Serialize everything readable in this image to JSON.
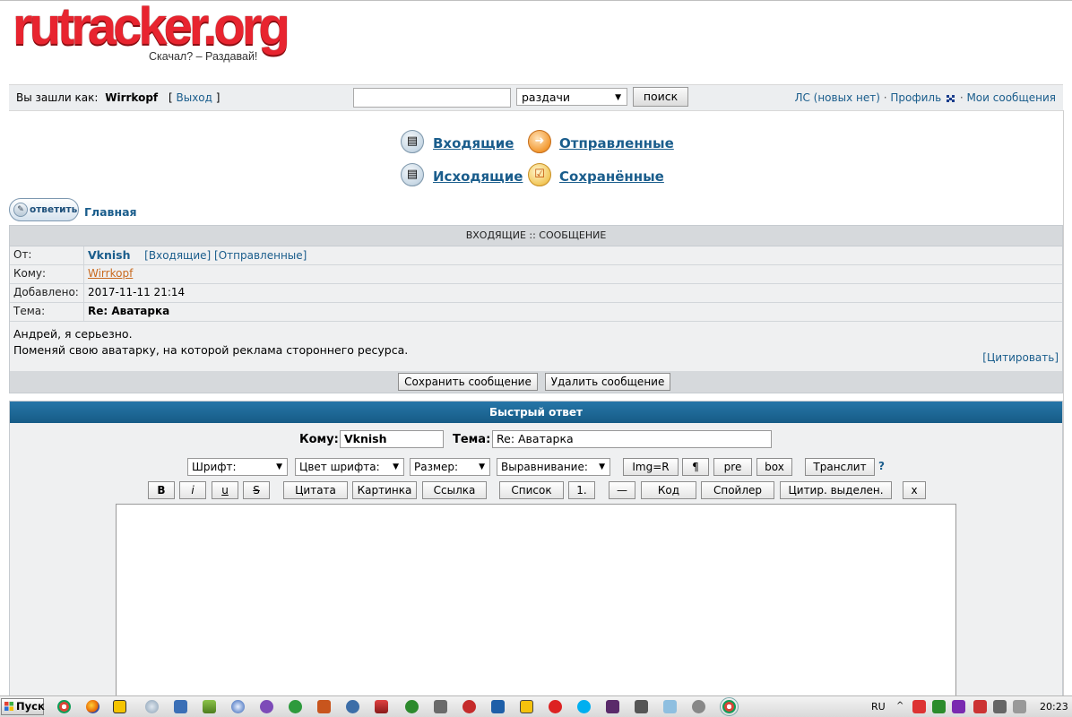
{
  "logo": {
    "text": "rutracker.org",
    "slogan": "Скачал? – Раздавай!"
  },
  "topbar": {
    "logged_as_label": "Вы зашли как:",
    "username": "Wirrkopf",
    "logout_label": "Выход",
    "search_value": "",
    "search_scope": "раздачи",
    "search_button": "поиск",
    "pm_link": "ЛС (новых нет)",
    "profile_link": "Профиль",
    "my_posts_link": "Мои сообщения"
  },
  "folders": {
    "inbox": "Входящие",
    "sent": "Отправленные",
    "outbox": "Исходящие",
    "saved": "Сохранённые"
  },
  "nav": {
    "reply_button": "ответить",
    "breadcrumb": "Главная"
  },
  "message": {
    "header": "ВХОДЯЩИЕ :: СООБЩЕНИЕ",
    "from_label": "От:",
    "from_value": "Vknish",
    "from_inbox_link": "[Входящие]",
    "from_sent_link": "[Отправленные]",
    "to_label": "Кому:",
    "to_value": "Wirrkopf",
    "date_label": "Добавлено:",
    "date_value": "2017-11-11 21:14",
    "subject_label": "Тема:",
    "subject_value": "Re: Аватарка",
    "body_line1": "Андрей, я серьезно.",
    "body_line2": "Поменяй свою аватарку, на которой реклама стороннего ресурса.",
    "quote_link": "[Цитировать]",
    "save_button": "Сохранить сообщение",
    "delete_button": "Удалить сообщение"
  },
  "quick_reply": {
    "title": "Быстрый ответ",
    "to_label": "Кому:",
    "to_value": "Vknish",
    "subject_label": "Тема:",
    "subject_value": "Re: Аватарка",
    "font_select": "Шрифт:",
    "color_select": "Цвет шрифта:",
    "size_select": "Размер:",
    "align_select": "Выравнивание:",
    "img_r": "Img=R",
    "pilcrow": "¶",
    "pre": "pre",
    "box": "box",
    "translit": "Транслит",
    "help": "?",
    "bold": "B",
    "italic": "i",
    "underline": "u",
    "strike": "S",
    "quote": "Цитата",
    "image": "Картинка",
    "link": "Ссылка",
    "list": "Список",
    "list_num": "1.",
    "hr": "—",
    "code": "Код",
    "spoiler": "Спойлер",
    "quote_selected": "Цитир. выделен.",
    "close": "x"
  },
  "taskbar": {
    "start": "Пуск",
    "lang": "RU",
    "clock": "20:23"
  }
}
